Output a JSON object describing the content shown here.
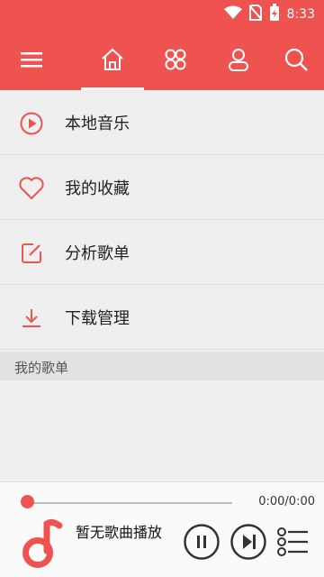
{
  "status_bar": {
    "time": "8:33",
    "icons": [
      "wifi-icon",
      "no-sim-icon",
      "battery-charging-icon"
    ]
  },
  "toolbar": {
    "icons": [
      "menu-icon",
      "home-icon",
      "discover-icon",
      "user-icon",
      "search-icon"
    ],
    "active_tab": "home-icon",
    "accent_color": "#ee5350"
  },
  "menu": {
    "items": [
      {
        "label": "本地音乐",
        "icon": "play-circle-icon"
      },
      {
        "label": "我的收藏",
        "icon": "heart-icon"
      },
      {
        "label": "分析歌单",
        "icon": "edit-icon"
      },
      {
        "label": "下载管理",
        "icon": "download-icon"
      }
    ]
  },
  "playlists": {
    "header": "我的歌单"
  },
  "player": {
    "time": "0:00/0:00",
    "progress": 0,
    "now_playing": "暂无歌曲播放",
    "controls": [
      "pause-icon",
      "next-icon",
      "playlist-icon"
    ]
  }
}
